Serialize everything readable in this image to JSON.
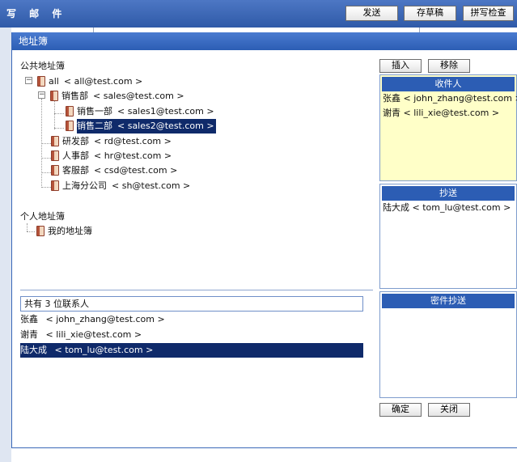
{
  "compose": {
    "title": "写 邮 件",
    "send_label": "发送",
    "draft_label": "存草稿",
    "spellcheck_label": "拼写检查"
  },
  "dialog": {
    "title": "地址簿",
    "public_book_label": "公共地址簿",
    "personal_book_label": "个人地址簿",
    "public_tree": [
      {
        "name": "all",
        "email": "< all@test.com >"
      },
      {
        "name": "销售部",
        "email": "< sales@test.com >"
      },
      {
        "name": "销售一部",
        "email": "< sales1@test.com >"
      },
      {
        "name": "销售二部",
        "email": "< sales2@test.com >"
      },
      {
        "name": "研发部",
        "email": "< rd@test.com >"
      },
      {
        "name": "人事部",
        "email": "< hr@test.com >"
      },
      {
        "name": "客服部",
        "email": "< csd@test.com >"
      },
      {
        "name": "上海分公司",
        "email": "< sh@test.com >"
      }
    ],
    "personal_tree": [
      {
        "name": "我的地址簿"
      }
    ],
    "contacts_summary": "共有  3 位联系人",
    "contacts": [
      {
        "name": "张鑫",
        "email": "< john_zhang@test.com >"
      },
      {
        "name": "谢青",
        "email": "< lili_xie@test.com >"
      },
      {
        "name": "陆大成",
        "email": "< tom_lu@test.com >"
      }
    ],
    "insert_label": "插入",
    "remove_label": "移除",
    "ok_label": "确定",
    "close_label": "关闭",
    "to": {
      "header": "收件人",
      "items": [
        {
          "text": "张鑫 < john_zhang@test.com >"
        },
        {
          "text": "谢青 < lili_xie@test.com >"
        }
      ]
    },
    "cc": {
      "header": "抄送",
      "items": [
        {
          "text": "陆大成 < tom_lu@test.com >"
        }
      ]
    },
    "bcc": {
      "header": "密件抄送",
      "items": []
    }
  },
  "colors": {
    "title_bar": "#2c5db4",
    "selection": "#0f2a6a",
    "to_box_bg": "#ffffc8",
    "border": "#7e9ccd"
  }
}
